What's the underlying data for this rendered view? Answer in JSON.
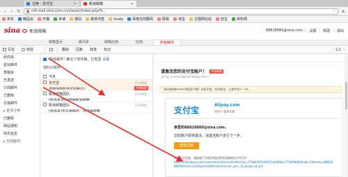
{
  "browser": {
    "tabs": [
      {
        "label": "注册 - 支付宝"
      },
      {
        "label": "新浪邮箱"
      }
    ],
    "url": "m0.mail.sina.com.cn/classic/index.php?fr...",
    "bookmarks": [
      "京东",
      "精品会",
      "天猫",
      "米读",
      "建站",
      "其他书签",
      "study",
      "百度在线翻译",
      "网易",
      "淘宝",
      "主题网站站",
      "旺宝",
      "资料网"
    ]
  },
  "header": {
    "logo_text": "sina",
    "service_name": "新浪邮箱",
    "user_email": "88818880@sina.com",
    "user_links": [
      "设置",
      "帮助",
      "退出"
    ]
  },
  "nav_tabs": [
    "邮箱首页",
    "通讯录",
    "邮箱应用",
    "应用",
    "所有邮件"
  ],
  "toolbar": {
    "write_label": "写信",
    "receive_label": "收信",
    "delete_label": "删除",
    "reply_label": "回复",
    "forward_label": "转发",
    "mark_label": "标记",
    "page_info": "1/1"
  },
  "sidebar": {
    "items": [
      {
        "label": "收件夹"
      },
      {
        "label": "星标邮件"
      },
      {
        "label": "草稿夹"
      },
      {
        "label": "已发送"
      },
      {
        "label": "订阅邮件"
      },
      {
        "label": "已删除"
      },
      {
        "label": "垃圾邮件"
      },
      {
        "label": "▸ 更多分类",
        "group": true
      },
      {
        "label": "已删除"
      },
      {
        "label": "网站通知"
      },
      {
        "label": "商讯信息"
      },
      {
        "label": "▸ 代收邮件",
        "group": true
      }
    ]
  },
  "list": {
    "notice_text": "\"所有邮件\" 聚合了收件箱、已发送",
    "notice_link": "设置",
    "sort_label": "按时间排序",
    "group_label": "今天",
    "mails": [
      {
        "from": "支付宝",
        "subject": "请激活您的支付宝账户！",
        "time": "21分钟前",
        "tag": "中国邮政"
      },
      {
        "from": "新浪邮箱团队",
        "subject": "[收件夹]欢迎使用新浪邮箱",
        "time": "23分钟前",
        "tag": ""
      },
      {
        "from": "新浪邮箱团队",
        "subject": "[收件夹]不在电脑前，这样用邮箱…",
        "time": "23分钟前",
        "tag": ""
      }
    ]
  },
  "reader": {
    "title": "请激活您的支付宝账户！",
    "title_tag": "中国邮政",
    "from_line": "支付宝 <service@mail.alipay.com>",
    "banner": "【新浪邮箱android版客户端】全新亮相，实时推送，让邮件快人一步。",
    "alipay_logo": "支付宝",
    "alipay_url": "Alipay.com",
    "alipay_tagline": "知托付 值得信赖",
    "greeting": "亲爱的88818880@sina.com，",
    "instruction": "您的账户即将激活，请激活账户进行下一步。",
    "cta_label": "激活注册",
    "fallback_text": "如果点击无效，请复制下方网页地址到浏览器地址栏中打开：",
    "fallback_link": "https://lab.alipay.com/user/activeUser/valid.htm?ac=37bb4383340455ac683ba771983b8a6ea4=3&email=88818880%40sina.com&parentIdtime&channel_user_id=&sign=8_pf3"
  },
  "colors": {
    "sina_red": "#d2001f",
    "alipay_blue": "#1a8ad6",
    "cta_orange": "#f39c12",
    "annotation_red": "#e52d2d"
  }
}
